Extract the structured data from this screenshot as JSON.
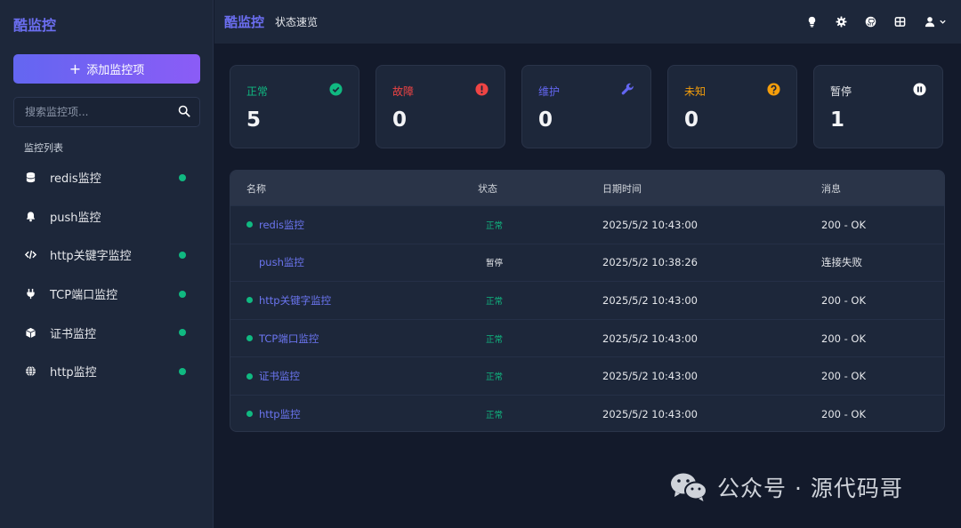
{
  "app": {
    "logo": "酷监控"
  },
  "sidebar": {
    "add_button": "添加监控项",
    "search_placeholder": "搜索监控项...",
    "section_title": "监控列表",
    "items": [
      {
        "label": "redis监控",
        "icon": "database-icon",
        "online": true
      },
      {
        "label": "push监控",
        "icon": "bell-icon",
        "online": false
      },
      {
        "label": "http关键字监控",
        "icon": "code-icon",
        "online": true
      },
      {
        "label": "TCP端口监控",
        "icon": "plug-icon",
        "online": true
      },
      {
        "label": "证书监控",
        "icon": "cube-icon",
        "online": true
      },
      {
        "label": "http监控",
        "icon": "globe-icon",
        "online": true
      }
    ]
  },
  "header": {
    "brand": "酷监控",
    "subtitle": "状态速览",
    "tools": [
      "lightbulb-icon",
      "gear-icon",
      "github-icon",
      "grid-icon",
      "user-menu-icon"
    ]
  },
  "cards": [
    {
      "label": "正常",
      "value": "5",
      "color": "#10b981",
      "icon": "check-circle-icon"
    },
    {
      "label": "故障",
      "value": "0",
      "color": "#ef4444",
      "icon": "alert-circle-icon"
    },
    {
      "label": "维护",
      "value": "0",
      "color": "#6366f1",
      "icon": "wrench-icon"
    },
    {
      "label": "未知",
      "value": "0",
      "color": "#f59e0b",
      "icon": "question-circle-icon"
    },
    {
      "label": "暂停",
      "value": "1",
      "color": "#e5e7eb",
      "icon": "pause-circle-icon"
    }
  ],
  "table": {
    "headers": [
      "名称",
      "状态",
      "日期时间",
      "消息"
    ],
    "rows": [
      {
        "name": "redis监控",
        "status": "正常",
        "datetime": "2025/5/2 10:43:00",
        "message": "200 - OK",
        "online": true
      },
      {
        "name": "push监控",
        "status": "暂停",
        "datetime": "2025/5/2 10:38:26",
        "message": "连接失败",
        "online": false
      },
      {
        "name": "http关键字监控",
        "status": "正常",
        "datetime": "2025/5/2 10:43:00",
        "message": "200 - OK",
        "online": true
      },
      {
        "name": "TCP端口监控",
        "status": "正常",
        "datetime": "2025/5/2 10:43:00",
        "message": "200 - OK",
        "online": true
      },
      {
        "name": "证书监控",
        "status": "正常",
        "datetime": "2025/5/2 10:43:00",
        "message": "200 - OK",
        "online": true
      },
      {
        "name": "http监控",
        "status": "正常",
        "datetime": "2025/5/2 10:43:00",
        "message": "200 - OK",
        "online": true
      }
    ]
  },
  "watermark": {
    "text": "公众号 · 源代码哥"
  }
}
